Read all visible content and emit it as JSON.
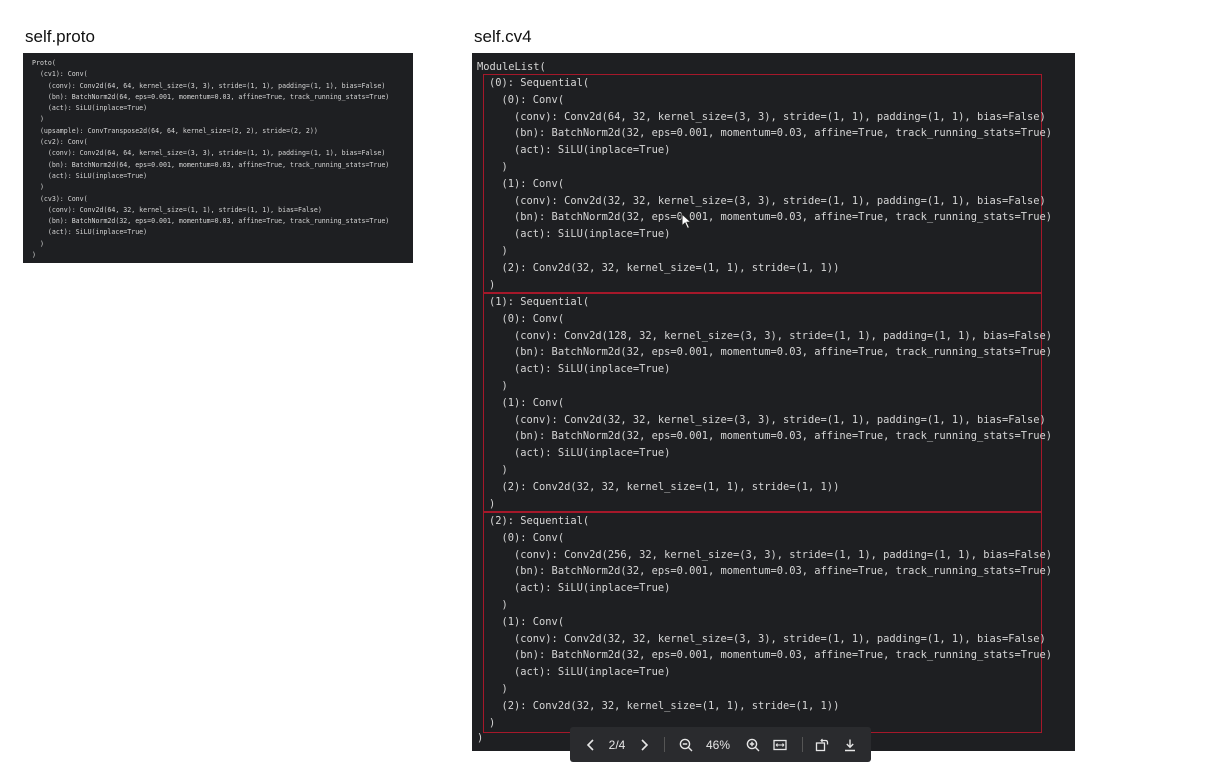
{
  "panels": {
    "proto": {
      "title": "self.proto",
      "code": "Proto(\n  (cv1): Conv(\n    (conv): Conv2d(64, 64, kernel_size=(3, 3), stride=(1, 1), padding=(1, 1), bias=False)\n    (bn): BatchNorm2d(64, eps=0.001, momentum=0.03, affine=True, track_running_stats=True)\n    (act): SiLU(inplace=True)\n  )\n  (upsample): ConvTranspose2d(64, 64, kernel_size=(2, 2), stride=(2, 2))\n  (cv2): Conv(\n    (conv): Conv2d(64, 64, kernel_size=(3, 3), stride=(1, 1), padding=(1, 1), bias=False)\n    (bn): BatchNorm2d(64, eps=0.001, momentum=0.03, affine=True, track_running_stats=True)\n    (act): SiLU(inplace=True)\n  )\n  (cv3): Conv(\n    (conv): Conv2d(64, 32, kernel_size=(1, 1), stride=(1, 1), bias=False)\n    (bn): BatchNorm2d(32, eps=0.001, momentum=0.03, affine=True, track_running_stats=True)\n    (act): SiLU(inplace=True)\n  )\n)"
    },
    "cv4": {
      "title": "self.cv4",
      "head": "ModuleList(",
      "blocks": [
        "(0): Sequential(\n  (0): Conv(\n    (conv): Conv2d(64, 32, kernel_size=(3, 3), stride=(1, 1), padding=(1, 1), bias=False)\n    (bn): BatchNorm2d(32, eps=0.001, momentum=0.03, affine=True, track_running_stats=True)\n    (act): SiLU(inplace=True)\n  )\n  (1): Conv(\n    (conv): Conv2d(32, 32, kernel_size=(3, 3), stride=(1, 1), padding=(1, 1), bias=False)\n    (bn): BatchNorm2d(32, eps=0.001, momentum=0.03, affine=True, track_running_stats=True)\n    (act): SiLU(inplace=True)\n  )\n  (2): Conv2d(32, 32, kernel_size=(1, 1), stride=(1, 1))\n)",
        "(1): Sequential(\n  (0): Conv(\n    (conv): Conv2d(128, 32, kernel_size=(3, 3), stride=(1, 1), padding=(1, 1), bias=False)\n    (bn): BatchNorm2d(32, eps=0.001, momentum=0.03, affine=True, track_running_stats=True)\n    (act): SiLU(inplace=True)\n  )\n  (1): Conv(\n    (conv): Conv2d(32, 32, kernel_size=(3, 3), stride=(1, 1), padding=(1, 1), bias=False)\n    (bn): BatchNorm2d(32, eps=0.001, momentum=0.03, affine=True, track_running_stats=True)\n    (act): SiLU(inplace=True)\n  )\n  (2): Conv2d(32, 32, kernel_size=(1, 1), stride=(1, 1))\n)",
        "(2): Sequential(\n  (0): Conv(\n    (conv): Conv2d(256, 32, kernel_size=(3, 3), stride=(1, 1), padding=(1, 1), bias=False)\n    (bn): BatchNorm2d(32, eps=0.001, momentum=0.03, affine=True, track_running_stats=True)\n    (act): SiLU(inplace=True)\n  )\n  (1): Conv(\n    (conv): Conv2d(32, 32, kernel_size=(3, 3), stride=(1, 1), padding=(1, 1), bias=False)\n    (bn): BatchNorm2d(32, eps=0.001, momentum=0.03, affine=True, track_running_stats=True)\n    (act): SiLU(inplace=True)\n  )\n  (2): Conv2d(32, 32, kernel_size=(1, 1), stride=(1, 1))\n)"
      ],
      "tail": ")"
    }
  },
  "viewer": {
    "page_indicator": "2/4",
    "zoom_level": "46%",
    "icons": [
      "chevron-left-icon",
      "chevron-right-icon",
      "zoom-out-icon",
      "zoom-in-icon",
      "fit-width-icon",
      "rotate-icon",
      "download-icon"
    ]
  },
  "colors": {
    "code_background": "#1e1f22",
    "code_text": "#d6d6d6",
    "highlight_border": "#a5182a",
    "toolbar_background": "#2a2b2e"
  }
}
